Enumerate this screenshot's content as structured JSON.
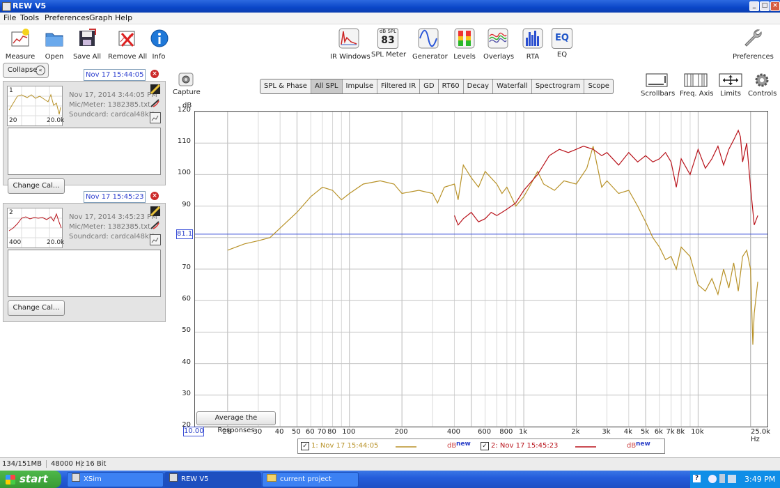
{
  "window": {
    "title": "REW V5"
  },
  "menu": [
    "File",
    "Tools",
    "Preferences",
    "Graph",
    "Help"
  ],
  "toolbar": {
    "measure": "Measure",
    "open": "Open",
    "save_all": "Save All",
    "remove_all": "Remove All",
    "info": "Info",
    "ir_windows": "IR Windows",
    "spl_meter": "SPL Meter",
    "spl_meter_unit": "dB SPL",
    "spl_meter_value": "83",
    "generator": "Generator",
    "levels": "Levels",
    "overlays": "Overlays",
    "rta": "RTA",
    "eq": "EQ",
    "eq_icon_text": "EQ",
    "preferences": "Preferences"
  },
  "left_panel": {
    "collapse": "Collapse",
    "measurements": [
      {
        "index": "1",
        "date_field": "Nov 17 15:44:05",
        "date": "Nov 17, 2014 3:44:05 PM",
        "mic": "Mic/Meter: 1382385.txt",
        "soundcard": "Soundcard: cardcal48kHz",
        "thumb_left": "20",
        "thumb_right": "20.0k",
        "change_cal": "Change Cal..."
      },
      {
        "index": "2",
        "date_field": "Nov 17 15:45:23",
        "date": "Nov 17, 2014 3:45:23 PM",
        "mic": "Mic/Meter: 1382385.txt",
        "soundcard": "Soundcard: cardcal48kHz",
        "thumb_left": "400",
        "thumb_right": "20.0k",
        "change_cal": "Change Cal..."
      }
    ]
  },
  "capture": "Capture",
  "tabs": [
    "SPL & Phase",
    "All SPL",
    "Impulse",
    "Filtered IR",
    "GD",
    "RT60",
    "Decay",
    "Waterfall",
    "Spectrogram",
    "Scope"
  ],
  "selected_tab": "All SPL",
  "right_tools": {
    "scrollbars": "Scrollbars",
    "freq_axis": "Freq. Axis",
    "limits": "Limits",
    "controls": "Controls"
  },
  "average_button": "Average the Responses",
  "cursor_y_label": "81.1",
  "x_start_label": "10.00",
  "legend": [
    {
      "label": "1: Nov 17 15:44:05",
      "unit": "dB",
      "tag": "new",
      "color": "#b89228"
    },
    {
      "label": "2: Nov 17 15:45:23",
      "unit": "dB",
      "tag": "new",
      "color": "#b8121a"
    }
  ],
  "status": {
    "memory": "134/151MB",
    "rate": "48000 Hz",
    "bits": "16 Bit"
  },
  "taskbar": {
    "start": "start",
    "tasks": [
      "XSim",
      "REW V5",
      "current project"
    ],
    "clock": "3:49 PM"
  },
  "chart_data": {
    "type": "line",
    "ylabel": "dB",
    "ylim": [
      20,
      120
    ],
    "yticks": [
      20,
      30,
      40,
      50,
      60,
      70,
      80,
      90,
      100,
      110,
      120
    ],
    "xscale": "log",
    "xlim": [
      13,
      25000
    ],
    "xtick_values": [
      20,
      30,
      40,
      50,
      60,
      70,
      80,
      100,
      200,
      400,
      600,
      800,
      1000,
      2000,
      3000,
      4000,
      5000,
      6000,
      7000,
      8000,
      10000
    ],
    "xtick_labels": [
      "20",
      "30",
      "40",
      "50",
      "60",
      "70",
      "80",
      "100",
      "200",
      "400",
      "600",
      "800",
      "1k",
      "2k",
      "3k",
      "4k",
      "5k",
      "6k",
      "7k",
      "8k",
      "10k"
    ],
    "x_end_label": "25.0k Hz",
    "cursor_y": 81.1,
    "series": [
      {
        "name": "1: Nov 17 15:44:05",
        "color": "#b89228",
        "points": [
          [
            20,
            76
          ],
          [
            25,
            78
          ],
          [
            30,
            79
          ],
          [
            35,
            80
          ],
          [
            40,
            83
          ],
          [
            50,
            88
          ],
          [
            60,
            93
          ],
          [
            70,
            96
          ],
          [
            80,
            95
          ],
          [
            90,
            92
          ],
          [
            100,
            94
          ],
          [
            120,
            97
          ],
          [
            150,
            98
          ],
          [
            180,
            97
          ],
          [
            200,
            94
          ],
          [
            250,
            95
          ],
          [
            300,
            94
          ],
          [
            320,
            91
          ],
          [
            350,
            96
          ],
          [
            400,
            97
          ],
          [
            420,
            92
          ],
          [
            450,
            103
          ],
          [
            500,
            99
          ],
          [
            550,
            96
          ],
          [
            600,
            101
          ],
          [
            700,
            97
          ],
          [
            750,
            94
          ],
          [
            800,
            96
          ],
          [
            900,
            90
          ],
          [
            1000,
            93
          ],
          [
            1100,
            97
          ],
          [
            1200,
            101
          ],
          [
            1300,
            97
          ],
          [
            1500,
            95
          ],
          [
            1700,
            98
          ],
          [
            2000,
            97
          ],
          [
            2300,
            102
          ],
          [
            2500,
            109
          ],
          [
            2800,
            96
          ],
          [
            3000,
            98
          ],
          [
            3500,
            94
          ],
          [
            4000,
            95
          ],
          [
            4500,
            90
          ],
          [
            5000,
            85
          ],
          [
            5500,
            80
          ],
          [
            6000,
            77
          ],
          [
            6500,
            73
          ],
          [
            7000,
            74
          ],
          [
            7500,
            70
          ],
          [
            8000,
            77
          ],
          [
            9000,
            74
          ],
          [
            10000,
            65
          ],
          [
            11000,
            63
          ],
          [
            12000,
            67
          ],
          [
            13000,
            62
          ],
          [
            14000,
            70
          ],
          [
            15000,
            64
          ],
          [
            16000,
            72
          ],
          [
            17000,
            63
          ],
          [
            18000,
            74
          ],
          [
            19000,
            76
          ],
          [
            20000,
            70
          ],
          [
            20600,
            46
          ],
          [
            21000,
            56
          ],
          [
            22000,
            66
          ]
        ]
      },
      {
        "name": "2: Nov 17 15:45:23",
        "color": "#b8121a",
        "points": [
          [
            400,
            87
          ],
          [
            420,
            84
          ],
          [
            450,
            86
          ],
          [
            500,
            88
          ],
          [
            550,
            85
          ],
          [
            600,
            86
          ],
          [
            650,
            88
          ],
          [
            700,
            87
          ],
          [
            750,
            88
          ],
          [
            800,
            89
          ],
          [
            900,
            91
          ],
          [
            1000,
            95
          ],
          [
            1200,
            100
          ],
          [
            1400,
            106
          ],
          [
            1600,
            108
          ],
          [
            1800,
            107
          ],
          [
            2000,
            108
          ],
          [
            2200,
            109
          ],
          [
            2500,
            108
          ],
          [
            2800,
            106
          ],
          [
            3000,
            107
          ],
          [
            3500,
            103
          ],
          [
            4000,
            107
          ],
          [
            4500,
            104
          ],
          [
            5000,
            106
          ],
          [
            5500,
            104
          ],
          [
            6000,
            105
          ],
          [
            6500,
            107
          ],
          [
            7000,
            104
          ],
          [
            7500,
            96
          ],
          [
            8000,
            105
          ],
          [
            9000,
            100
          ],
          [
            10000,
            108
          ],
          [
            11000,
            102
          ],
          [
            12000,
            105
          ],
          [
            13000,
            109
          ],
          [
            14000,
            103
          ],
          [
            15000,
            108
          ],
          [
            16000,
            111
          ],
          [
            17000,
            114
          ],
          [
            17500,
            112
          ],
          [
            18000,
            104
          ],
          [
            19000,
            110
          ],
          [
            20000,
            96
          ],
          [
            21000,
            84
          ],
          [
            22000,
            87
          ]
        ]
      }
    ]
  }
}
